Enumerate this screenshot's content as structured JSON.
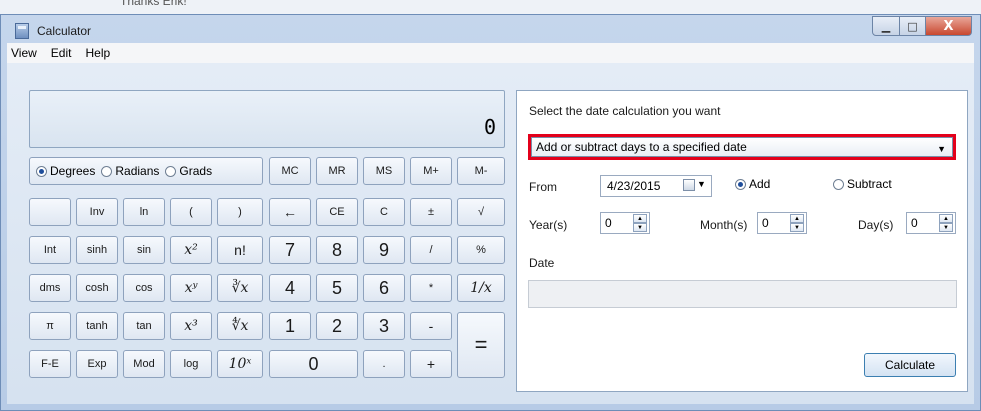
{
  "background_text": "Thanks Erik!",
  "window": {
    "title": "Calculator",
    "close_glyph": "X"
  },
  "menu": [
    "View",
    "Edit",
    "Help"
  ],
  "display": {
    "value": "0"
  },
  "angle_units": {
    "options": [
      "Degrees",
      "Radians",
      "Grads"
    ],
    "selected": "Degrees"
  },
  "memory_row": [
    "MC",
    "MR",
    "MS",
    "M+",
    "M-"
  ],
  "buttons": {
    "r2": [
      "",
      "Inv",
      "ln",
      "(",
      ")",
      "←",
      "CE",
      "C",
      "±",
      "√"
    ],
    "r3": [
      "Int",
      "sinh",
      "sin",
      "x²",
      "n!",
      "7",
      "8",
      "9",
      "/",
      "%"
    ],
    "r4": [
      "dms",
      "cosh",
      "cos",
      "xʸ",
      "∛x",
      "4",
      "5",
      "6",
      "*",
      "1/x"
    ],
    "r5": [
      "π",
      "tanh",
      "tan",
      "x³",
      "∜x",
      "1",
      "2",
      "3",
      "-",
      "="
    ],
    "r6": [
      "F-E",
      "Exp",
      "Mod",
      "log",
      "10ˣ",
      "0",
      ".",
      "+"
    ]
  },
  "date_calc": {
    "prompt": "Select the date calculation you want",
    "mode": "Add or subtract days to a specified date",
    "from_label": "From",
    "from_date": "4/23/2015",
    "add_label": "Add",
    "subtract_label": "Subtract",
    "selected_op": "Add",
    "years_label": "Year(s)",
    "years_value": "0",
    "months_label": "Month(s)",
    "months_value": "0",
    "days_label": "Day(s)",
    "days_value": "0",
    "date_label": "Date",
    "result": "",
    "calculate_label": "Calculate"
  }
}
